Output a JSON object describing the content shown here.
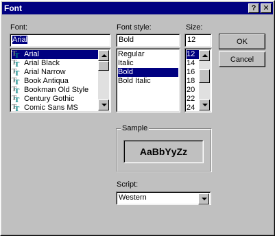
{
  "window": {
    "title": "Font",
    "help_label": "?",
    "close_label": "✕"
  },
  "font": {
    "label": "Font:",
    "value": "Arial",
    "items": [
      {
        "label": "Arial",
        "selected": true
      },
      {
        "label": "Arial Black"
      },
      {
        "label": "Arial Narrow"
      },
      {
        "label": "Book Antiqua"
      },
      {
        "label": "Bookman Old Style"
      },
      {
        "label": "Century Gothic"
      },
      {
        "label": "Comic Sans MS"
      }
    ],
    "item_icon": "truetype-icon"
  },
  "style": {
    "label": "Font style:",
    "value": "Bold",
    "items": [
      {
        "label": "Regular"
      },
      {
        "label": "Italic"
      },
      {
        "label": "Bold",
        "selected": true
      },
      {
        "label": "Bold Italic"
      }
    ]
  },
  "size": {
    "label": "Size:",
    "value": "12",
    "items": [
      {
        "label": "12",
        "selected": true
      },
      {
        "label": "14"
      },
      {
        "label": "16"
      },
      {
        "label": "18"
      },
      {
        "label": "20"
      },
      {
        "label": "22"
      },
      {
        "label": "24"
      }
    ]
  },
  "buttons": {
    "ok": "OK",
    "cancel": "Cancel"
  },
  "sample": {
    "title": "Sample",
    "text": "AaBbYyZz"
  },
  "script": {
    "label": "Script:",
    "value": "Western"
  },
  "colors": {
    "title_bar": "#000080",
    "face": "#c0c0c0",
    "selection": "#000080"
  }
}
